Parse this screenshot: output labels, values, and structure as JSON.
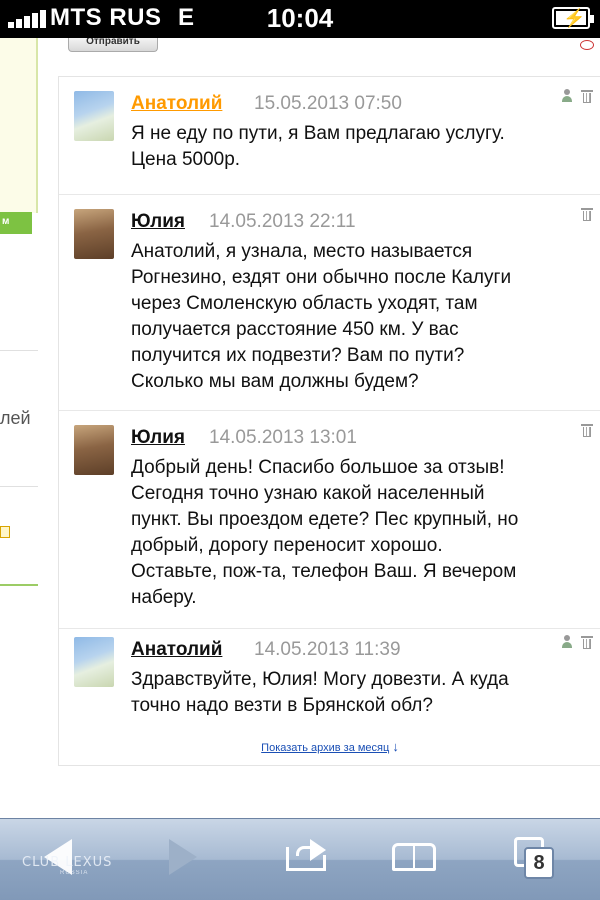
{
  "status_bar": {
    "carrier": "MTS RUS",
    "network": "E",
    "time": "10:04"
  },
  "side_panel": {
    "tab_label": "м",
    "partial_text": "лей"
  },
  "form": {
    "send_label": "Отправить"
  },
  "comments": [
    {
      "author": "Анатолий",
      "date": "15.05.2013 07:50",
      "text_lines": [
        "Я не еду по пути, я Вам предлагаю услугу.",
        "Цена 5000р."
      ],
      "author_color": "#ff9a00",
      "icons": [
        "user-icon",
        "trash-icon"
      ]
    },
    {
      "author": "Юлия",
      "date": "14.05.2013 22:11",
      "text_lines": [
        "Анатолий, я узнала, место называется",
        "Рогнезино, ездят они обычно после Калуги",
        "через Смоленскую область уходят, там",
        "получается расстояние 450 км. У вас",
        "получится их подвезти? Вам по пути?",
        "Сколько мы вам должны будем?"
      ],
      "icons": [
        "trash-icon"
      ]
    },
    {
      "author": "Юлия",
      "date": "14.05.2013 13:01",
      "text_lines": [
        "Добрый день! Спасибо большое за отзыв!",
        "Сегодня точно узнаю какой населенный",
        "пункт. Вы проездом едете? Пес крупный, но",
        "добрый, дорогу переносит хорошо.",
        "Оставьте, пож-та, телефон Ваш. Я вечером",
        "наберу."
      ],
      "icons": [
        "trash-icon"
      ]
    },
    {
      "author": "Анатолий",
      "date": "14.05.2013 11:39",
      "text_lines": [
        "Здравствуйте, Юлия! Могу довезти. А куда",
        "точно надо везти в Брянской обл?"
      ],
      "icons": [
        "user-icon",
        "trash-icon"
      ]
    }
  ],
  "archive_link": "Показать архив за месяц",
  "toolbar": {
    "tabs_count": "8",
    "watermark": "CLUB LEXUS",
    "watermark_sub": "RUSSIA"
  }
}
